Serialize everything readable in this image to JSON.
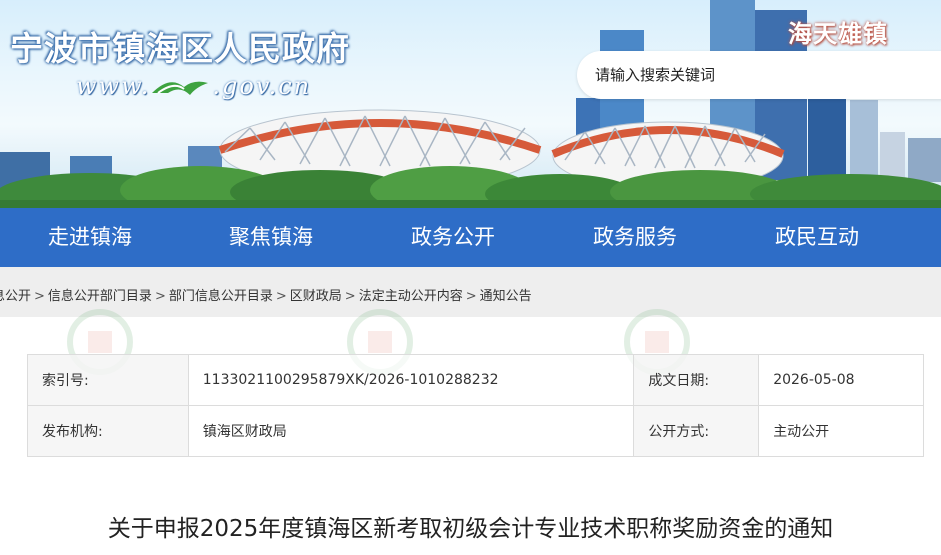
{
  "site": {
    "title": "宁波市镇海区人民政府",
    "url_prefix": "www.",
    "url_suffix": ".gov.cn",
    "slogan": "海天雄镇"
  },
  "search": {
    "placeholder": "请输入搜索关键词"
  },
  "nav": {
    "items": [
      {
        "label": "走进镇海"
      },
      {
        "label": "聚焦镇海"
      },
      {
        "label": "政务公开"
      },
      {
        "label": "政务服务"
      },
      {
        "label": "政民互动"
      }
    ]
  },
  "breadcrumb": {
    "items": [
      "息公开",
      "信息公开部门目录",
      "部门信息公开目录",
      "区财政局",
      "法定主动公开内容",
      "通知公告"
    ],
    "separator": ">"
  },
  "meta": {
    "index_label": "索引号:",
    "index_value": "1133021100295879XK/2026-1010288232",
    "date_label": "成文日期:",
    "date_value": "2026-05-08",
    "publisher_label": "发布机构:",
    "publisher_value": "镇海区财政局",
    "mode_label": "公开方式:",
    "mode_value": "主动公开"
  },
  "document": {
    "title": "关于申报2025年度镇海区新考取初级会计专业技术职称奖励资金的通知"
  },
  "colors": {
    "nav_bg": "#2e6dc7",
    "breadcrumb_bg": "#eeeeee",
    "title_shadow": "#3a74b8",
    "slogan_shadow": "#c85a4a"
  }
}
